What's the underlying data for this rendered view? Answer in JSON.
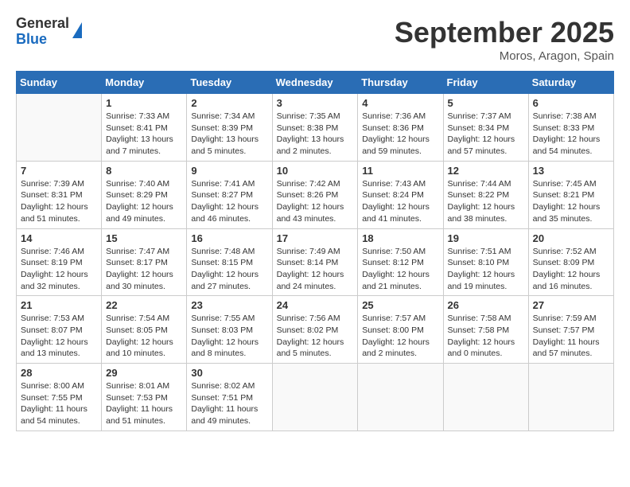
{
  "header": {
    "logo_general": "General",
    "logo_blue": "Blue",
    "month": "September 2025",
    "location": "Moros, Aragon, Spain"
  },
  "columns": [
    "Sunday",
    "Monday",
    "Tuesday",
    "Wednesday",
    "Thursday",
    "Friday",
    "Saturday"
  ],
  "weeks": [
    [
      {
        "day": "",
        "info": ""
      },
      {
        "day": "1",
        "info": "Sunrise: 7:33 AM\nSunset: 8:41 PM\nDaylight: 13 hours\nand 7 minutes."
      },
      {
        "day": "2",
        "info": "Sunrise: 7:34 AM\nSunset: 8:39 PM\nDaylight: 13 hours\nand 5 minutes."
      },
      {
        "day": "3",
        "info": "Sunrise: 7:35 AM\nSunset: 8:38 PM\nDaylight: 13 hours\nand 2 minutes."
      },
      {
        "day": "4",
        "info": "Sunrise: 7:36 AM\nSunset: 8:36 PM\nDaylight: 12 hours\nand 59 minutes."
      },
      {
        "day": "5",
        "info": "Sunrise: 7:37 AM\nSunset: 8:34 PM\nDaylight: 12 hours\nand 57 minutes."
      },
      {
        "day": "6",
        "info": "Sunrise: 7:38 AM\nSunset: 8:33 PM\nDaylight: 12 hours\nand 54 minutes."
      }
    ],
    [
      {
        "day": "7",
        "info": "Sunrise: 7:39 AM\nSunset: 8:31 PM\nDaylight: 12 hours\nand 51 minutes."
      },
      {
        "day": "8",
        "info": "Sunrise: 7:40 AM\nSunset: 8:29 PM\nDaylight: 12 hours\nand 49 minutes."
      },
      {
        "day": "9",
        "info": "Sunrise: 7:41 AM\nSunset: 8:27 PM\nDaylight: 12 hours\nand 46 minutes."
      },
      {
        "day": "10",
        "info": "Sunrise: 7:42 AM\nSunset: 8:26 PM\nDaylight: 12 hours\nand 43 minutes."
      },
      {
        "day": "11",
        "info": "Sunrise: 7:43 AM\nSunset: 8:24 PM\nDaylight: 12 hours\nand 41 minutes."
      },
      {
        "day": "12",
        "info": "Sunrise: 7:44 AM\nSunset: 8:22 PM\nDaylight: 12 hours\nand 38 minutes."
      },
      {
        "day": "13",
        "info": "Sunrise: 7:45 AM\nSunset: 8:21 PM\nDaylight: 12 hours\nand 35 minutes."
      }
    ],
    [
      {
        "day": "14",
        "info": "Sunrise: 7:46 AM\nSunset: 8:19 PM\nDaylight: 12 hours\nand 32 minutes."
      },
      {
        "day": "15",
        "info": "Sunrise: 7:47 AM\nSunset: 8:17 PM\nDaylight: 12 hours\nand 30 minutes."
      },
      {
        "day": "16",
        "info": "Sunrise: 7:48 AM\nSunset: 8:15 PM\nDaylight: 12 hours\nand 27 minutes."
      },
      {
        "day": "17",
        "info": "Sunrise: 7:49 AM\nSunset: 8:14 PM\nDaylight: 12 hours\nand 24 minutes."
      },
      {
        "day": "18",
        "info": "Sunrise: 7:50 AM\nSunset: 8:12 PM\nDaylight: 12 hours\nand 21 minutes."
      },
      {
        "day": "19",
        "info": "Sunrise: 7:51 AM\nSunset: 8:10 PM\nDaylight: 12 hours\nand 19 minutes."
      },
      {
        "day": "20",
        "info": "Sunrise: 7:52 AM\nSunset: 8:09 PM\nDaylight: 12 hours\nand 16 minutes."
      }
    ],
    [
      {
        "day": "21",
        "info": "Sunrise: 7:53 AM\nSunset: 8:07 PM\nDaylight: 12 hours\nand 13 minutes."
      },
      {
        "day": "22",
        "info": "Sunrise: 7:54 AM\nSunset: 8:05 PM\nDaylight: 12 hours\nand 10 minutes."
      },
      {
        "day": "23",
        "info": "Sunrise: 7:55 AM\nSunset: 8:03 PM\nDaylight: 12 hours\nand 8 minutes."
      },
      {
        "day": "24",
        "info": "Sunrise: 7:56 AM\nSunset: 8:02 PM\nDaylight: 12 hours\nand 5 minutes."
      },
      {
        "day": "25",
        "info": "Sunrise: 7:57 AM\nSunset: 8:00 PM\nDaylight: 12 hours\nand 2 minutes."
      },
      {
        "day": "26",
        "info": "Sunrise: 7:58 AM\nSunset: 7:58 PM\nDaylight: 12 hours\nand 0 minutes."
      },
      {
        "day": "27",
        "info": "Sunrise: 7:59 AM\nSunset: 7:57 PM\nDaylight: 11 hours\nand 57 minutes."
      }
    ],
    [
      {
        "day": "28",
        "info": "Sunrise: 8:00 AM\nSunset: 7:55 PM\nDaylight: 11 hours\nand 54 minutes."
      },
      {
        "day": "29",
        "info": "Sunrise: 8:01 AM\nSunset: 7:53 PM\nDaylight: 11 hours\nand 51 minutes."
      },
      {
        "day": "30",
        "info": "Sunrise: 8:02 AM\nSunset: 7:51 PM\nDaylight: 11 hours\nand 49 minutes."
      },
      {
        "day": "",
        "info": ""
      },
      {
        "day": "",
        "info": ""
      },
      {
        "day": "",
        "info": ""
      },
      {
        "day": "",
        "info": ""
      }
    ]
  ]
}
